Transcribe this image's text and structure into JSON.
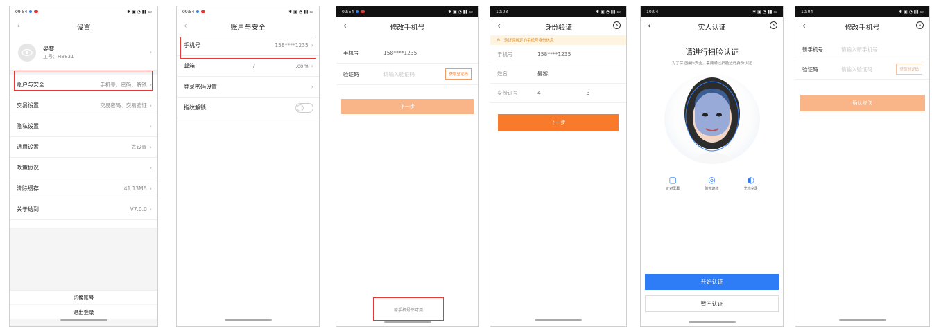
{
  "colors": {
    "accent_orange": "#f97a2a",
    "pale_orange": "#f9b488",
    "blue": "#2f7df6",
    "highlight_red": "#e53935"
  },
  "screens": [
    {
      "status_time": "09:54",
      "title": "设置",
      "profile": {
        "name": "晏黎",
        "job_no": "工号：HB831"
      },
      "items": [
        {
          "label": "账户与安全",
          "value": "手机号、密码、解锁"
        },
        {
          "label": "交易设置",
          "value": "交易密码、交易验证"
        },
        {
          "label": "隐私设置",
          "value": ""
        },
        {
          "label": "通用设置",
          "value": "去设置"
        },
        {
          "label": "政策协议",
          "value": ""
        },
        {
          "label": "清除缓存",
          "value": "41.13MB"
        },
        {
          "label": "关于给到",
          "value": "V7.0.0"
        }
      ],
      "switch_account": "切换账号",
      "logout": "退出登录"
    },
    {
      "status_time": "09:54",
      "title": "账户与安全",
      "items": [
        {
          "label": "手机号",
          "value": "158****1235"
        },
        {
          "label": "邮箱",
          "value_prefix": "7",
          "value_suffix": ".com"
        },
        {
          "label": "登录密码设置",
          "value": ""
        },
        {
          "label": "指纹解锁",
          "value": ""
        }
      ]
    },
    {
      "status_time": "09:54",
      "title": "修改手机号",
      "phone_label": "手机号",
      "phone_value": "158****1235",
      "code_label": "验证码",
      "code_placeholder": "请输入验证码",
      "code_button": "获取验证码",
      "next_button": "下一步",
      "unavailable_link": "原手机号不可用"
    },
    {
      "status_time": "10:03",
      "title": "身份验证",
      "notice": "验证原绑定的手机号身份信息",
      "fields": [
        {
          "label": "手机号",
          "value": "158****1235"
        },
        {
          "label": "姓名",
          "value": "晏黎"
        },
        {
          "label": "身份证号",
          "value_prefix": "4",
          "value_suffix": "3"
        }
      ],
      "next_button": "下一步"
    },
    {
      "status_time": "10:04",
      "title": "实人认证",
      "heading": "请进行扫脸认证",
      "subheading": "为了保证操作安全，需要通过扫脸进行身份认证",
      "tips": [
        "正对屏幕",
        "验光遮挡",
        "光线充足"
      ],
      "start_button": "开始认证",
      "skip_button": "暂不认证"
    },
    {
      "status_time": "10:04",
      "title": "修改手机号",
      "new_phone_label": "新手机号",
      "new_phone_placeholder": "请输入新手机号",
      "code_label": "验证码",
      "code_placeholder": "请输入验证码",
      "code_button": "获取验证码",
      "confirm_button": "确认修改"
    }
  ]
}
